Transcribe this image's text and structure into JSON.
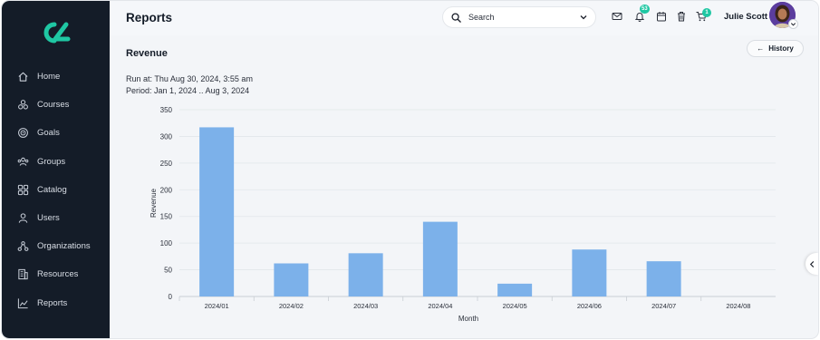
{
  "header": {
    "title": "Reports",
    "search_placeholder": "Search",
    "notifications_badge": "53",
    "cart_badge": "1",
    "user_name": "Julie Scott"
  },
  "sidebar": {
    "items": [
      {
        "label": "Home",
        "icon": "home-icon"
      },
      {
        "label": "Courses",
        "icon": "courses-icon"
      },
      {
        "label": "Goals",
        "icon": "target-icon"
      },
      {
        "label": "Groups",
        "icon": "users-group-icon"
      },
      {
        "label": "Catalog",
        "icon": "grid-icon"
      },
      {
        "label": "Users",
        "icon": "user-icon"
      },
      {
        "label": "Organizations",
        "icon": "org-icon"
      },
      {
        "label": "Resources",
        "icon": "building-icon"
      },
      {
        "label": "Reports",
        "icon": "chart-line-icon"
      }
    ]
  },
  "report": {
    "title": "Revenue",
    "history_label": "History",
    "run_at": "Run at: Thu Aug 30, 2024, 3:55 am",
    "period": "Period: Jan 1, 2024 .. Aug 3, 2024"
  },
  "colors": {
    "sidebar_bg": "#141c28",
    "bar": "#7cb1ea",
    "accent": "#1fc7a3"
  },
  "chart_data": {
    "type": "bar",
    "categories": [
      "2024/01",
      "2024/02",
      "2024/03",
      "2024/04",
      "2024/05",
      "2024/06",
      "2024/07",
      "2024/08"
    ],
    "values": [
      317,
      62,
      81,
      140,
      24,
      88,
      66,
      0
    ],
    "title": "",
    "xlabel": "Month",
    "ylabel": "Revenue",
    "ylim": [
      0,
      350
    ],
    "yticks": [
      0,
      50,
      100,
      150,
      200,
      250,
      300,
      350
    ],
    "grid": true,
    "legend": "none"
  }
}
